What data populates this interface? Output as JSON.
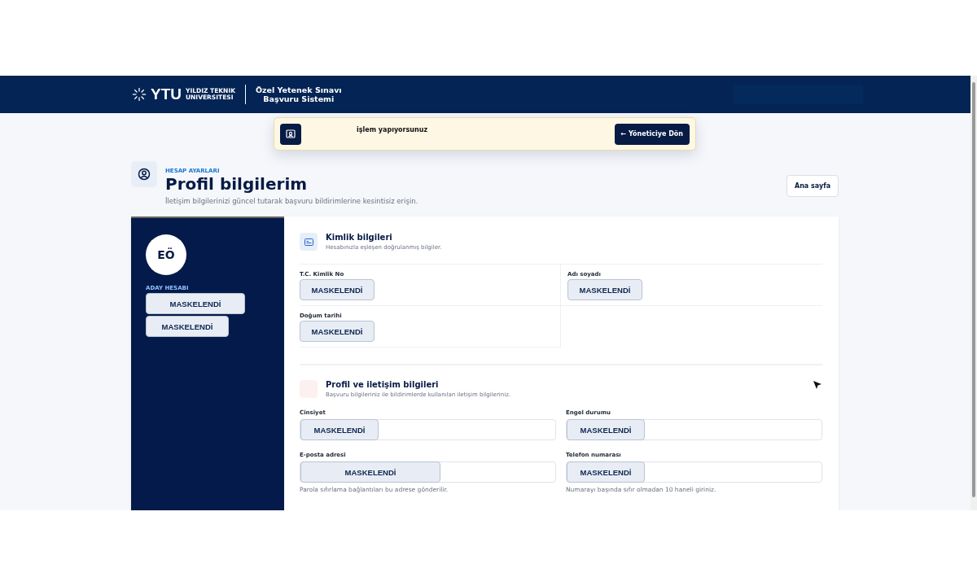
{
  "header": {
    "logo_mark": "YTU",
    "logo_lines": [
      "YILDIZ TEKNIK",
      "UNIVERSITESI"
    ],
    "system_lines": [
      "Özel Yetenek Sınavı",
      "Başvuru Sistemi"
    ]
  },
  "banner": {
    "message": "işlem yapıyorsunuz",
    "button_arrow": "←",
    "button": "Yöneticiye Dön"
  },
  "page": {
    "eyebrow": "HESAP AYARLARI",
    "title": "Profil bilgilerim",
    "subtitle": "İletişim bilgilerinizi güncel tutarak başvuru bildirimlerine kesintisiz erişin.",
    "home_button": "Ana sayfa"
  },
  "sidebar": {
    "initials": "EÖ",
    "account_label": "ADAY HESABI",
    "masked": [
      "MASKELENDİ",
      "MASKELENDİ"
    ]
  },
  "identity": {
    "title": "Kimlik bilgileri",
    "subtitle": "Hesabınızla eşleşen doğrulanmış bilgiler.",
    "fields": [
      {
        "label": "T.C. Kimlik No",
        "value": "MASKELENDİ"
      },
      {
        "label": "Adı soyadı",
        "value": "MASKELENDİ"
      },
      {
        "label": "Doğum tarihi",
        "value": "MASKELENDİ"
      }
    ]
  },
  "contact": {
    "title": "Profil ve iletişim bilgileri",
    "subtitle": "Başvuru bilgileriniz ile bildirimlerde kullanılan iletişim bilgileriniz.",
    "fields": [
      {
        "label": "Cinsiyet",
        "value": "MASKELENDİ"
      },
      {
        "label": "Engel durumu",
        "value": "MASKELENDİ"
      },
      {
        "label": "E-posta adresi",
        "value": "MASKELENDİ",
        "hint": "Parola sıfırlama bağlantıları bu adrese gönderilir."
      },
      {
        "label": "Telefon numarası",
        "value": "MASKELENDİ",
        "hint": "Numarayı başında sıfır olmadan 10 haneli giriniz."
      }
    ]
  }
}
